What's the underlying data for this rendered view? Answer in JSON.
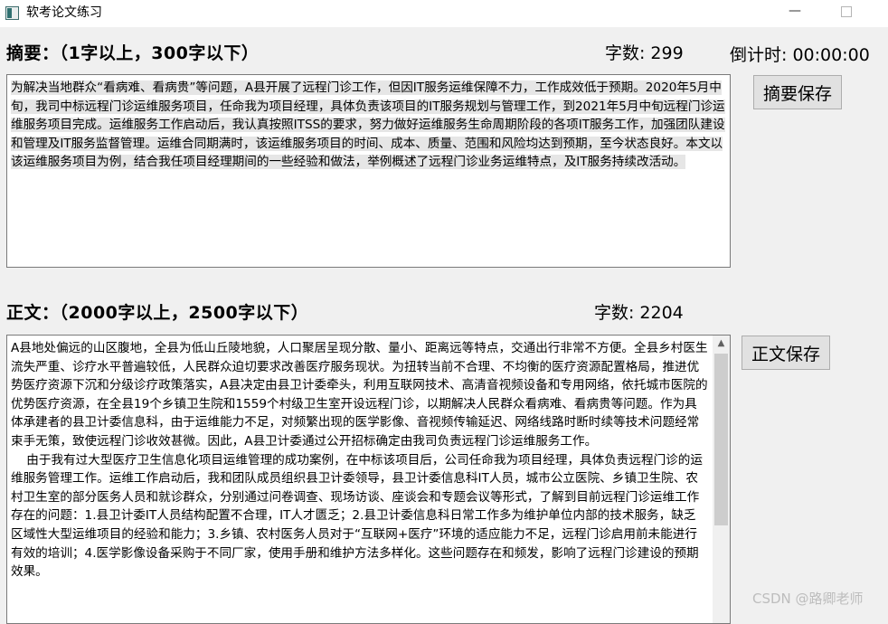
{
  "window": {
    "title": "软考论文练习",
    "minimize_glyph": "—"
  },
  "summary": {
    "heading": "摘要：（1字以上，300字以下）",
    "count_label": "字数:",
    "count_value": "299",
    "timer_label": "倒计时:",
    "timer_value": "00:00:00",
    "save_button": "摘要保存",
    "text": "为解决当地群众“看病难、看病贵”等问题，A县开展了远程门诊工作，但因IT服务运维保障不力，工作成效低于预期。2020年5月中旬，我司中标远程门诊运维服务项目，任命我为项目经理，具体负责该项目的IT服务规划与管理工作，到2021年5月中旬远程门诊运维服务项目完成。运维服务工作启动后，我认真按照ITSS的要求，努力做好运维服务生命周期阶段的各项IT服务工作，加强团队建设和管理及IT服务监督管理。运维合同期满时，该运维服务项目的时间、成本、质量、范围和风险均达到预期，至今状态良好。本文以该运维服务项目为例，结合我任项目经理期间的一些经验和做法，举例概述了远程门诊业务运维特点，及IT服务持续改活动。"
  },
  "body": {
    "heading": "正文：（2000字以上，2500字以下）",
    "count_label": "字数:",
    "count_value": "2204",
    "save_button": "正文保存",
    "text": "A县地处偏远的山区腹地，全县为低山丘陵地貌，人口聚居呈现分散、量小、距离远等特点，交通出行非常不方便。全县乡村医生流失严重、诊疗水平普遍较低，人民群众迫切要求改善医疗服务现状。为扭转当前不合理、不均衡的医疗资源配置格局，推进优势医疗资源下沉和分级诊疗政策落实，A县决定由县卫计委牵头，利用互联网技术、高清音视频设备和专用网络，依托城市医院的优势医疗资源，在全县19个乡镇卫生院和1559个村级卫生室开设远程门诊，以期解决人民群众看病难、看病贵等问题。作为具体承建者的县卫计委信息科，由于运维能力不足，对频繁出现的医学影像、音视频传输延迟、网络线路时断时续等技术问题经常束手无策，致使远程门诊收效甚微。因此，A县卫计委通过公开招标确定由我司负责远程门诊运维服务工作。\n    由于我有过大型医疗卫生信息化项目运维管理的成功案例，在中标该项目后，公司任命我为项目经理，具体负责远程门诊的运维服务管理工作。运维工作启动后，我和团队成员组织县卫计委领导，县卫计委信息科IT人员，城市公立医院、乡镇卫生院、农村卫生室的部分医务人员和就诊群众，分别通过问卷调查、现场访谈、座谈会和专题会议等形式，了解到目前远程门诊运维工作存在的问题：1.县卫计委IT人员结构配置不合理，IT人才匮乏；2.县卫计委信息科日常工作多为维护单位内部的技术服务，缺乏区域性大型运维项目的经验和能力；3.乡镇、农村医务人员对于“互联网+医疗”环境的适应能力不足，远程门诊启用前未能进行有效的培训；4.医学影像设备采购于不同厂家，使用手册和维护方法多样化。这些问题存在和频发，影响了远程门诊建设的预期效果。"
  },
  "watermark": "CSDN @路卿老师"
}
